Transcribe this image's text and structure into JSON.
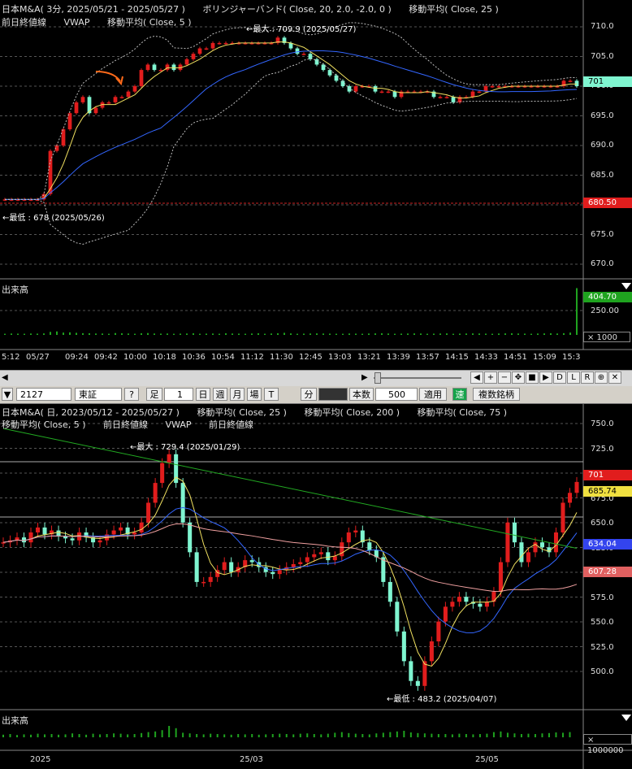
{
  "top": {
    "header_line1": [
      "日本M&A( 3分, 2025/05/21 - 2025/05/27 )",
      "ボリンジャーバンド( Close, 20, 2.0, -2.0, 0 )",
      "移動平均( Close, 25 )"
    ],
    "header_line2": [
      "前日終値線",
      "VWAP",
      "移動平均( Close, 5 )"
    ],
    "max_label": "←最大 : 709.9 (2025/05/27)",
    "min_label": "←最低 : 678 (2025/05/26)",
    "y_ticks": [
      "710.0",
      "705.0",
      "700.0",
      "695.0",
      "690.0",
      "685.0",
      "680.0",
      "675.0",
      "670.0"
    ],
    "tag_last": "701",
    "tag_prev": "680.50",
    "volume_label": "出来高",
    "vol_tag": "404.70",
    "vol_tick": "250.00",
    "vol_unit": "× 1000",
    "x_ticks": [
      "5:12",
      "05/27",
      "09:24",
      "09:42",
      "10:00",
      "10:18",
      "10:36",
      "10:54",
      "11:12",
      "11:30",
      "12:45",
      "13:03",
      "13:21",
      "13:39",
      "13:57",
      "14:15",
      "14:33",
      "14:51",
      "15:09",
      "15:3"
    ]
  },
  "toolbar": {
    "code": "2127",
    "market": "東証",
    "help": "?",
    "ashi": "足",
    "count": "1",
    "period_day": "日",
    "period_week": "週",
    "period_month": "月",
    "period_ba": "場",
    "period_t": "T",
    "bun": "分",
    "honsu": "本数",
    "honsu_val": "500",
    "apply": "適用",
    "soku": "速",
    "multi": "複数銘柄",
    "nav_buttons": [
      "◀",
      "+",
      "−",
      "✥",
      "■",
      "▶",
      "D",
      "L",
      "R",
      "⊕",
      "✕"
    ]
  },
  "bottom": {
    "header_line1": [
      "日本M&A( 日, 2023/05/12 - 2025/05/27 )",
      "移動平均( Close, 25 )",
      "移動平均( Close, 200 )",
      "移動平均( Close, 75 )"
    ],
    "header_line2": [
      "移動平均( Close, 5 )",
      "前日終値線",
      "VWAP",
      "前日終値線"
    ],
    "max_label": "←最大 : 729.4 (2025/01/29)",
    "min_label": "←最低 : 483.2 (2025/04/07)",
    "y_ticks": [
      "750.0",
      "725.0",
      "700.0",
      "675.0",
      "650.0",
      "625.0",
      "600.0",
      "575.0",
      "550.0",
      "525.0",
      "500.0"
    ],
    "tag_last": "701",
    "tag_ma25": "685.74",
    "tag_ma75": "634.04",
    "tag_ma200": "607.28",
    "volume_label": "出来高",
    "vol_unit": "× 1000000",
    "x_ticks": [
      "2025",
      "25/03",
      "25/05"
    ]
  },
  "colors": {
    "up": "#e11d1d",
    "down": "#7ff5d0",
    "ma5": "#f0e060",
    "ma25": "#3366ff",
    "ma75": "#f0a0a0",
    "ma200": "#22aa22",
    "vol": "#1fa31f",
    "prevclose": "#cc2222"
  },
  "chart_data": [
    {
      "type": "candlestick",
      "title": "日本M&A( 3分, 2025/05/21 - 2025/05/27 )",
      "ylim": [
        668,
        712
      ],
      "max": 709.9,
      "min": 678,
      "prev_close": 680.5,
      "last": 701,
      "closes": [
        680,
        680,
        680,
        680,
        680,
        680,
        681,
        689,
        690,
        693,
        696,
        698,
        699,
        696,
        697,
        698,
        698,
        699,
        699,
        700,
        701,
        704,
        705,
        704,
        704,
        705,
        704,
        705,
        706,
        707,
        708,
        708,
        709,
        709,
        709,
        709,
        709,
        709,
        709,
        709,
        709,
        709,
        710,
        709,
        708,
        707,
        707,
        706,
        705,
        704,
        703,
        702,
        701,
        700,
        701,
        701,
        701,
        700,
        700,
        700,
        699,
        700,
        700,
        700,
        700,
        700,
        699,
        699,
        699,
        698,
        699,
        699,
        700,
        700,
        701,
        701,
        701,
        701,
        701,
        701,
        701,
        701,
        701,
        701,
        701,
        701,
        702,
        702,
        701
      ],
      "volume": [
        10,
        12,
        11,
        10,
        12,
        11,
        13,
        26,
        30,
        20,
        22,
        18,
        15,
        14,
        12,
        12,
        10,
        16,
        14,
        12,
        10,
        14,
        16,
        12,
        11,
        12,
        10,
        11,
        12,
        14,
        10,
        11,
        12,
        10,
        14,
        12,
        11,
        10,
        12,
        14,
        10,
        12,
        14,
        18,
        13,
        10,
        11,
        12,
        13,
        12,
        11,
        10,
        10,
        12,
        11,
        10,
        12,
        13,
        14,
        12,
        10,
        11,
        12,
        13,
        12,
        10,
        11,
        12,
        13,
        10,
        11,
        12,
        13,
        12,
        11,
        10,
        12,
        13,
        14,
        12,
        11,
        10,
        12,
        13,
        14,
        12,
        15,
        20,
        404.7
      ]
    },
    {
      "type": "candlestick",
      "title": "日本M&A( 日, 2023/05/12 - 2025/05/27 )",
      "ylim": [
        485,
        760
      ],
      "max": 729.4,
      "min": 483.2,
      "last": 701,
      "ma25": 685.74,
      "ma75": 634.04,
      "ma200": 607.28,
      "closes": [
        640,
        642,
        645,
        640,
        650,
        655,
        648,
        652,
        646,
        644,
        642,
        650,
        645,
        640,
        642,
        648,
        652,
        655,
        648,
        650,
        660,
        680,
        700,
        720,
        729,
        700,
        660,
        630,
        600,
        600,
        605,
        612,
        620,
        610,
        615,
        622,
        620,
        615,
        610,
        608,
        612,
        615,
        618,
        620,
        625,
        628,
        630,
        622,
        626,
        640,
        650,
        652,
        640,
        632,
        625,
        600,
        580,
        550,
        520,
        500,
        495,
        520,
        540,
        560,
        575,
        580,
        585,
        580,
        578,
        575,
        580,
        590,
        620,
        660,
        640,
        620,
        630,
        640,
        635,
        630,
        650,
        680,
        690,
        701
      ],
      "volume": [
        0.8,
        1.0,
        0.7,
        0.9,
        0.8,
        1.1,
        0.9,
        1.0,
        0.8,
        0.9,
        1.2,
        1.0,
        0.8,
        1.1,
        0.9,
        1.0,
        1.2,
        1.1,
        0.9,
        1.0,
        1.3,
        1.6,
        1.8,
        2.2,
        3.5,
        2.8,
        1.4,
        1.2,
        1.0,
        0.9,
        1.1,
        1.0,
        0.9,
        0.8,
        1.0,
        0.9,
        1.0,
        0.8,
        0.9,
        1.0,
        1.1,
        1.0,
        0.9,
        1.1,
        1.2,
        1.0,
        0.9,
        1.1,
        1.4,
        1.6,
        1.3,
        1.1,
        1.0,
        0.9,
        1.2,
        1.4,
        1.6,
        1.8,
        2.0,
        1.5,
        1.3,
        1.2,
        1.1,
        1.0,
        1.0,
        0.9,
        1.1,
        1.0,
        0.9,
        1.0,
        1.1,
        1.6,
        1.8,
        1.4,
        1.2,
        1.0,
        1.1,
        1.0,
        1.2,
        1.3,
        1.5,
        1.4,
        1.6
      ]
    }
  ]
}
